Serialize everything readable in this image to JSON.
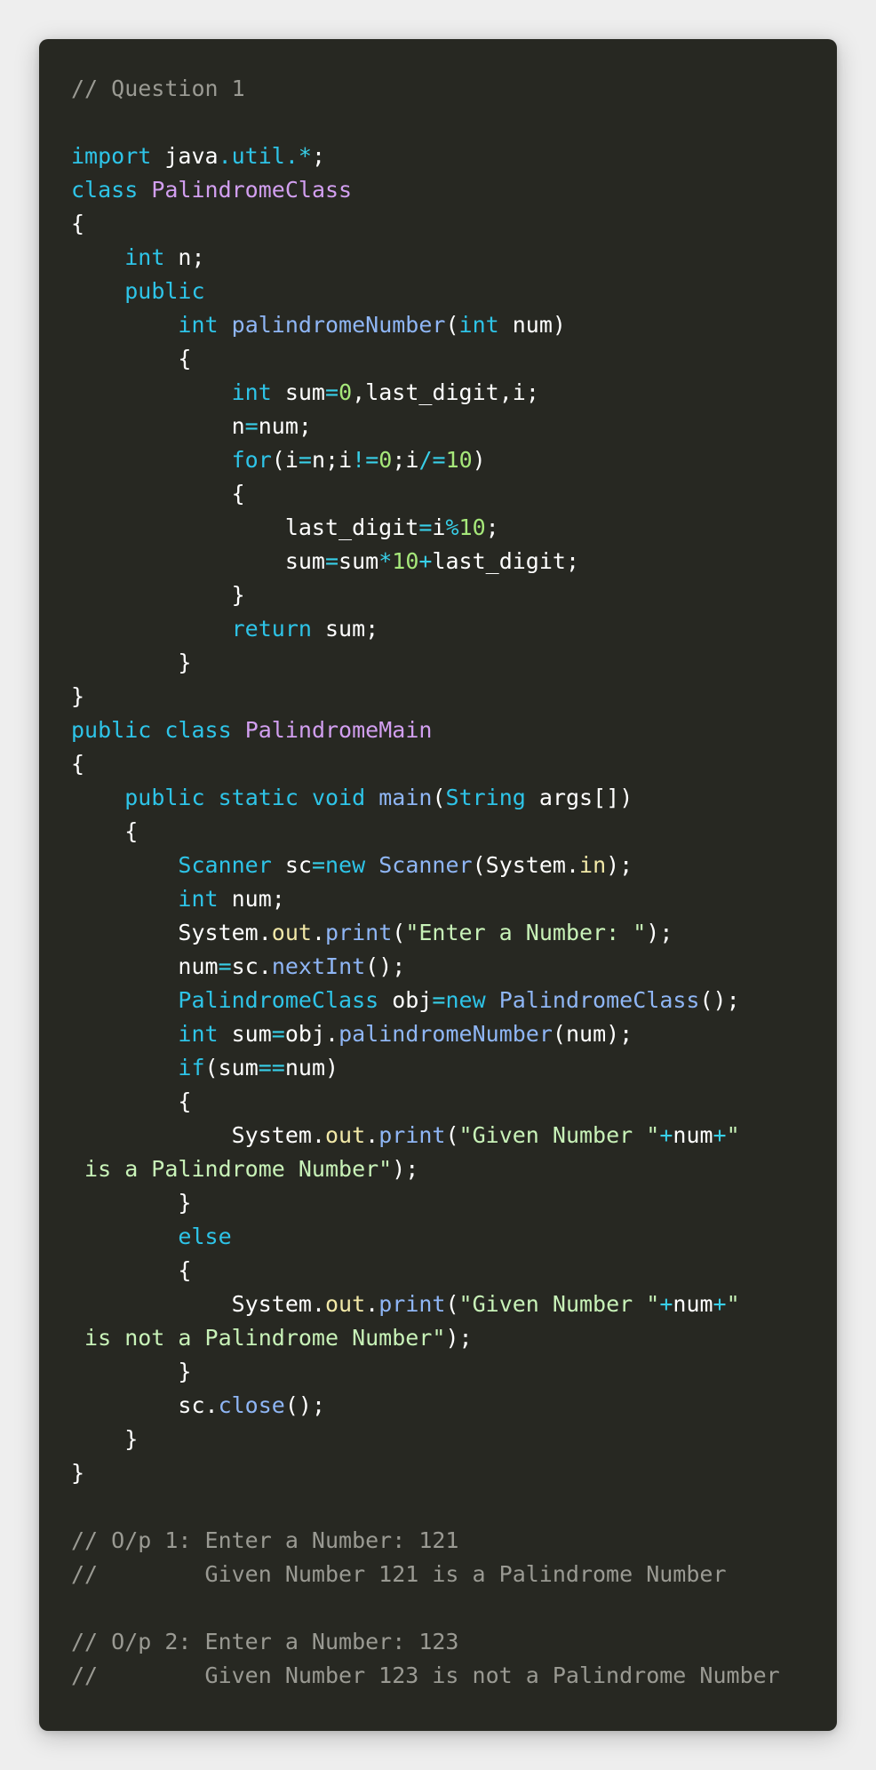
{
  "colors": {
    "background": "#eeeeee",
    "editor_background": "#272822",
    "comment": "#9a9a93",
    "keyword": "#2ec4e8",
    "class_name": "#d29ff0",
    "function": "#8fb6f5",
    "number": "#a6e87a",
    "string": "#c8f2b8",
    "identifier": "#ffffff",
    "property": "#f2e9a8",
    "operator": "#38cfe8"
  },
  "code_block": {
    "language": "java",
    "lines": [
      [
        [
          "cm",
          "// Question 1"
        ]
      ],
      [],
      [
        [
          "kw",
          "import"
        ],
        [
          "id",
          " java"
        ],
        [
          "kw",
          ".util."
        ],
        [
          "op",
          "*"
        ],
        [
          "pu",
          ";"
        ]
      ],
      [
        [
          "kw",
          "class"
        ],
        [
          "id",
          " "
        ],
        [
          "cl",
          "PalindromeClass"
        ]
      ],
      [
        [
          "pu",
          "{"
        ]
      ],
      [
        [
          "id",
          "    "
        ],
        [
          "kw",
          "int"
        ],
        [
          "id",
          " n"
        ],
        [
          "pu",
          ";"
        ]
      ],
      [
        [
          "id",
          "    "
        ],
        [
          "kw",
          "public"
        ]
      ],
      [
        [
          "id",
          "        "
        ],
        [
          "kw",
          "int"
        ],
        [
          "id",
          " "
        ],
        [
          "fn",
          "palindromeNumber"
        ],
        [
          "pu",
          "("
        ],
        [
          "kw",
          "int"
        ],
        [
          "id",
          " num"
        ],
        [
          "pu",
          ")"
        ]
      ],
      [
        [
          "id",
          "        "
        ],
        [
          "pu",
          "{"
        ]
      ],
      [
        [
          "id",
          "            "
        ],
        [
          "kw",
          "int"
        ],
        [
          "id",
          " sum"
        ],
        [
          "op",
          "="
        ],
        [
          "nm",
          "0"
        ],
        [
          "pu",
          ","
        ],
        [
          "id",
          "last_digit"
        ],
        [
          "pu",
          ","
        ],
        [
          "id",
          "i"
        ],
        [
          "pu",
          ";"
        ]
      ],
      [
        [
          "id",
          "            n"
        ],
        [
          "op",
          "="
        ],
        [
          "id",
          "num"
        ],
        [
          "pu",
          ";"
        ]
      ],
      [
        [
          "id",
          "            "
        ],
        [
          "kw",
          "for"
        ],
        [
          "pu",
          "("
        ],
        [
          "id",
          "i"
        ],
        [
          "op",
          "="
        ],
        [
          "id",
          "n"
        ],
        [
          "pu",
          ";"
        ],
        [
          "id",
          "i"
        ],
        [
          "op",
          "!="
        ],
        [
          "nm",
          "0"
        ],
        [
          "pu",
          ";"
        ],
        [
          "id",
          "i"
        ],
        [
          "op",
          "/="
        ],
        [
          "nm",
          "10"
        ],
        [
          "pu",
          ")"
        ]
      ],
      [
        [
          "id",
          "            "
        ],
        [
          "pu",
          "{"
        ]
      ],
      [
        [
          "id",
          "                last_digit"
        ],
        [
          "op",
          "="
        ],
        [
          "id",
          "i"
        ],
        [
          "op",
          "%"
        ],
        [
          "nm",
          "10"
        ],
        [
          "pu",
          ";"
        ]
      ],
      [
        [
          "id",
          "                sum"
        ],
        [
          "op",
          "="
        ],
        [
          "id",
          "sum"
        ],
        [
          "op",
          "*"
        ],
        [
          "nm",
          "10"
        ],
        [
          "op",
          "+"
        ],
        [
          "id",
          "last_digit"
        ],
        [
          "pu",
          ";"
        ]
      ],
      [
        [
          "id",
          "            "
        ],
        [
          "pu",
          "}"
        ]
      ],
      [
        [
          "id",
          "            "
        ],
        [
          "kw",
          "return"
        ],
        [
          "id",
          " sum"
        ],
        [
          "pu",
          ";"
        ]
      ],
      [
        [
          "id",
          "        "
        ],
        [
          "pu",
          "}"
        ]
      ],
      [
        [
          "pu",
          "}"
        ]
      ],
      [
        [
          "kw",
          "public"
        ],
        [
          "id",
          " "
        ],
        [
          "kw",
          "class"
        ],
        [
          "id",
          " "
        ],
        [
          "cl",
          "PalindromeMain"
        ]
      ],
      [
        [
          "pu",
          "{"
        ]
      ],
      [
        [
          "id",
          "    "
        ],
        [
          "kw",
          "public"
        ],
        [
          "id",
          " "
        ],
        [
          "kw",
          "static"
        ],
        [
          "id",
          " "
        ],
        [
          "kw",
          "void"
        ],
        [
          "id",
          " "
        ],
        [
          "fn",
          "main"
        ],
        [
          "pu",
          "("
        ],
        [
          "kw",
          "String"
        ],
        [
          "id",
          " args"
        ],
        [
          "pu",
          "[])"
        ]
      ],
      [
        [
          "id",
          "    "
        ],
        [
          "pu",
          "{"
        ]
      ],
      [
        [
          "id",
          "        "
        ],
        [
          "kw",
          "Scanner"
        ],
        [
          "id",
          " sc"
        ],
        [
          "op",
          "="
        ],
        [
          "kw",
          "new"
        ],
        [
          "id",
          " "
        ],
        [
          "fn",
          "Scanner"
        ],
        [
          "pu",
          "("
        ],
        [
          "id",
          "System"
        ],
        [
          "pu",
          "."
        ],
        [
          "pr",
          "in"
        ],
        [
          "pu",
          ");"
        ]
      ],
      [
        [
          "id",
          "        "
        ],
        [
          "kw",
          "int"
        ],
        [
          "id",
          " num"
        ],
        [
          "pu",
          ";"
        ]
      ],
      [
        [
          "id",
          "        System"
        ],
        [
          "pu",
          "."
        ],
        [
          "pr",
          "out"
        ],
        [
          "pu",
          "."
        ],
        [
          "fn",
          "print"
        ],
        [
          "pu",
          "("
        ],
        [
          "st",
          "\"Enter a Number: \""
        ],
        [
          "pu",
          ");"
        ]
      ],
      [
        [
          "id",
          "        num"
        ],
        [
          "op",
          "="
        ],
        [
          "id",
          "sc"
        ],
        [
          "pu",
          "."
        ],
        [
          "fn",
          "nextInt"
        ],
        [
          "pu",
          "();"
        ]
      ],
      [
        [
          "id",
          "        "
        ],
        [
          "kw",
          "PalindromeClass"
        ],
        [
          "id",
          " obj"
        ],
        [
          "op",
          "="
        ],
        [
          "kw",
          "new"
        ],
        [
          "id",
          " "
        ],
        [
          "fn",
          "PalindromeClass"
        ],
        [
          "pu",
          "();"
        ]
      ],
      [
        [
          "id",
          "        "
        ],
        [
          "kw",
          "int"
        ],
        [
          "id",
          " sum"
        ],
        [
          "op",
          "="
        ],
        [
          "id",
          "obj"
        ],
        [
          "pu",
          "."
        ],
        [
          "fn",
          "palindromeNumber"
        ],
        [
          "pu",
          "("
        ],
        [
          "id",
          "num"
        ],
        [
          "pu",
          ");"
        ]
      ],
      [
        [
          "id",
          "        "
        ],
        [
          "kw",
          "if"
        ],
        [
          "pu",
          "("
        ],
        [
          "id",
          "sum"
        ],
        [
          "op",
          "=="
        ],
        [
          "id",
          "num"
        ],
        [
          "pu",
          ")"
        ]
      ],
      [
        [
          "id",
          "        "
        ],
        [
          "pu",
          "{"
        ]
      ],
      [
        [
          "id",
          "            System"
        ],
        [
          "pu",
          "."
        ],
        [
          "pr",
          "out"
        ],
        [
          "pu",
          "."
        ],
        [
          "fn",
          "print"
        ],
        [
          "pu",
          "("
        ],
        [
          "st",
          "\"Given Number \""
        ],
        [
          "op",
          "+"
        ],
        [
          "id",
          "num"
        ],
        [
          "op",
          "+"
        ],
        [
          "st",
          "\""
        ]
      ],
      [
        [
          "st",
          " is a Palindrome Number\""
        ],
        [
          "pu",
          ");"
        ]
      ],
      [
        [
          "id",
          "        "
        ],
        [
          "pu",
          "}"
        ]
      ],
      [
        [
          "id",
          "        "
        ],
        [
          "kw",
          "else"
        ]
      ],
      [
        [
          "id",
          "        "
        ],
        [
          "pu",
          "{"
        ]
      ],
      [
        [
          "id",
          "            System"
        ],
        [
          "pu",
          "."
        ],
        [
          "pr",
          "out"
        ],
        [
          "pu",
          "."
        ],
        [
          "fn",
          "print"
        ],
        [
          "pu",
          "("
        ],
        [
          "st",
          "\"Given Number \""
        ],
        [
          "op",
          "+"
        ],
        [
          "id",
          "num"
        ],
        [
          "op",
          "+"
        ],
        [
          "st",
          "\""
        ]
      ],
      [
        [
          "st",
          " is not a Palindrome Number\""
        ],
        [
          "pu",
          ");"
        ]
      ],
      [
        [
          "id",
          "        "
        ],
        [
          "pu",
          "}"
        ]
      ],
      [
        [
          "id",
          "        sc"
        ],
        [
          "pu",
          "."
        ],
        [
          "fn",
          "close"
        ],
        [
          "pu",
          "();"
        ]
      ],
      [
        [
          "id",
          "    "
        ],
        [
          "pu",
          "}"
        ]
      ],
      [
        [
          "pu",
          "}"
        ]
      ],
      [],
      [
        [
          "cm",
          "// O/p 1: Enter a Number: 121"
        ]
      ],
      [
        [
          "cm",
          "//        Given Number 121 is a Palindrome Number"
        ]
      ],
      [],
      [
        [
          "cm",
          "// O/p 2: Enter a Number: 123"
        ]
      ],
      [
        [
          "cm",
          "//        Given Number 123 is not a Palindrome Number"
        ]
      ]
    ]
  }
}
